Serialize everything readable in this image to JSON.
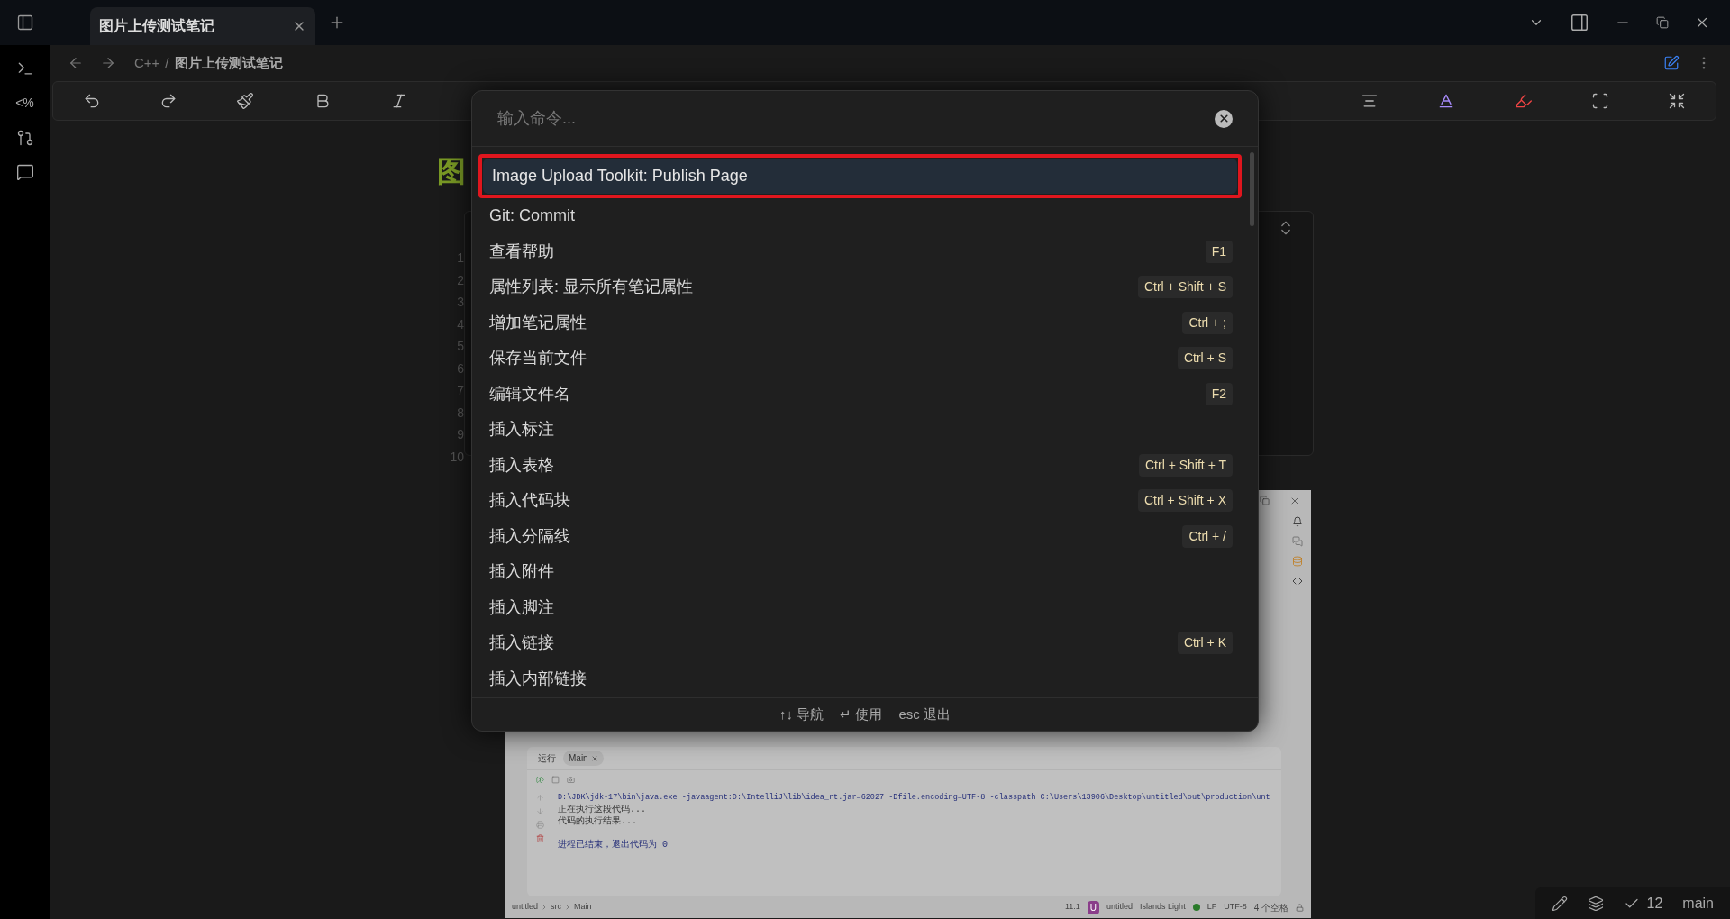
{
  "titlebar": {
    "tabs": [
      {
        "title": "图片上传测试笔记",
        "selected": true
      }
    ]
  },
  "ribbon": {
    "template_glyph": "<%"
  },
  "breadcrumb": {
    "folder": "C++",
    "separator": "/",
    "note": "图片上传测试笔记"
  },
  "note": {
    "heading": "图",
    "line_numbers": [
      "1",
      "2",
      "3",
      "4",
      "5",
      "6",
      "7",
      "8",
      "9",
      "10"
    ]
  },
  "ide_screenshot": {
    "run_label": "运行",
    "run_tab": "Main",
    "console_lines": [
      {
        "kind": "command",
        "text": "D:\\JDK\\jdk-17\\bin\\java.exe -javaagent:D:\\IntelliJ\\lib\\idea_rt.jar=62027 -Dfile.encoding=UTF-8 -classpath C:\\Users\\13906\\Desktop\\untitled\\out\\production\\unt"
      },
      {
        "kind": "output",
        "text": "正在执行这段代码..."
      },
      {
        "kind": "output",
        "text": "代码的执行结果..."
      },
      {
        "kind": "blank"
      },
      {
        "kind": "exit",
        "text": "进程已结束，退出代码为 0"
      }
    ],
    "path": [
      "untitled",
      "src",
      "Main"
    ],
    "status": {
      "position": "11:1",
      "project_badge": "U",
      "project": "untitled",
      "theme": "Islands Light",
      "line_ending": "LF",
      "encoding": "UTF-8",
      "indent": "4 个空格"
    }
  },
  "command_palette": {
    "placeholder": "输入命令...",
    "commands": [
      {
        "label": "Image Upload Toolkit: Publish Page",
        "selected": true
      },
      {
        "label": "Git: Commit",
        "selected": false
      },
      {
        "label": "查看帮助",
        "hotkey": "F1",
        "selected": false
      },
      {
        "label": "属性列表: 显示所有笔记属性",
        "hotkey": "Ctrl + Shift + S",
        "selected": false
      },
      {
        "label": "增加笔记属性",
        "hotkey": "Ctrl + ;",
        "selected": false
      },
      {
        "label": "保存当前文件",
        "hotkey": "Ctrl + S",
        "selected": false
      },
      {
        "label": "编辑文件名",
        "hotkey": "F2",
        "selected": false
      },
      {
        "label": "插入标注",
        "selected": false
      },
      {
        "label": "插入表格",
        "hotkey": "Ctrl + Shift + T",
        "selected": false
      },
      {
        "label": "插入代码块",
        "hotkey": "Ctrl + Shift + X",
        "selected": false
      },
      {
        "label": "插入分隔线",
        "hotkey": "Ctrl + /",
        "selected": false
      },
      {
        "label": "插入附件",
        "selected": false
      },
      {
        "label": "插入脚注",
        "selected": false
      },
      {
        "label": "插入链接",
        "hotkey": "Ctrl + K",
        "selected": false
      },
      {
        "label": "插入内部链接",
        "selected": false
      }
    ],
    "footer": [
      {
        "key": "↑↓",
        "action": "导航"
      },
      {
        "key": "↵",
        "action": "使用"
      },
      {
        "key": "esc",
        "action": "退出"
      }
    ]
  },
  "status_bar": {
    "count": "12",
    "branch": "main"
  }
}
